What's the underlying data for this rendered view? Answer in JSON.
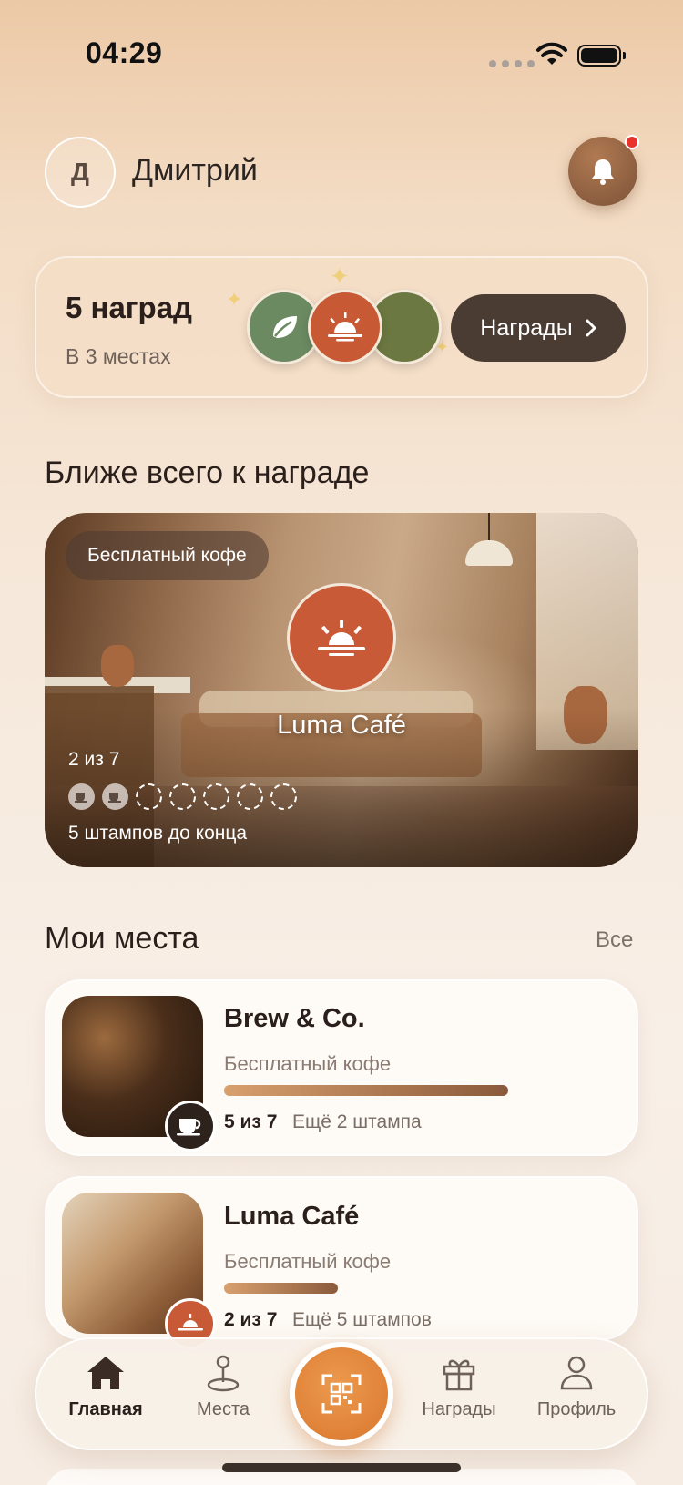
{
  "status_bar": {
    "time": "04:29"
  },
  "header": {
    "avatar_initial": "Д",
    "user_name": "Дмитрий"
  },
  "rewards_summary": {
    "count_text": "5 наград",
    "places_text": "В 3 местах",
    "button_label": "Награды"
  },
  "closest": {
    "section_title": "Ближе всего к награде",
    "reward_pill": "Бесплатный кофе",
    "cafe_name": "Luma Café",
    "progress_text": "2 из 7",
    "stamps_filled": 2,
    "stamps_total": 7,
    "remaining_text": "5 штампов до конца"
  },
  "my_places": {
    "section_title": "Мои места",
    "see_all": "Все",
    "items": [
      {
        "name": "Brew & Co.",
        "reward": "Бесплатный кофе",
        "count": "5 из 7",
        "left": "Ещё 2 штампа",
        "progress": 0.71,
        "badge_icon": "coffee-cup-icon"
      },
      {
        "name": "Luma Café",
        "reward": "Бесплатный кофе",
        "count": "2 из 7",
        "left": "Ещё 5 штампов",
        "progress": 0.29,
        "badge_icon": "sunrise-icon"
      }
    ]
  },
  "tabbar": {
    "home": "Главная",
    "places": "Места",
    "rewards": "Награды",
    "profile": "Профиль",
    "active": "home"
  },
  "colors": {
    "accent": "#d9772e",
    "dark_button": "#4a3b33",
    "luma_brand": "#c95a37",
    "notification_dot": "#e8322b"
  }
}
